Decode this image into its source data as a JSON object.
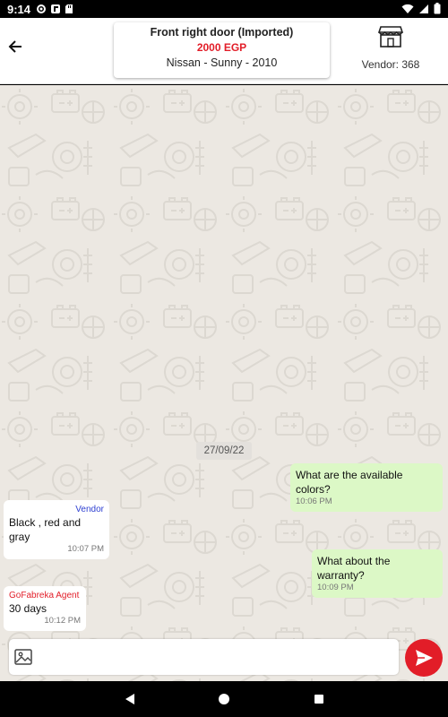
{
  "status_bar": {
    "time": "9:14"
  },
  "header": {
    "product_title": "Front right door (Imported)",
    "product_price": "2000 EGP",
    "product_car": "Nissan - Sunny - 2010",
    "vendor_label": "Vendor: 368"
  },
  "chat": {
    "date_separator": "27/09/22",
    "messages": [
      {
        "direction": "out",
        "sender": "",
        "text": "What are the available colors?",
        "time": "10:06 PM"
      },
      {
        "direction": "in",
        "sender": "Vendor",
        "text": "Black , red and gray",
        "time": "10:07 PM"
      },
      {
        "direction": "out",
        "sender": "",
        "text": "What about the warranty?",
        "time": "10:09 PM"
      },
      {
        "direction": "in",
        "sender": "GoFabreka Agent",
        "text": "30 days",
        "time": "10:12 PM"
      }
    ]
  },
  "composer": {
    "value": "",
    "placeholder": ""
  },
  "colors": {
    "accent": "#e21d28",
    "outgoing_bubble": "#dcf8c6",
    "incoming_bubble": "#ffffff",
    "chat_background": "#ece8e2",
    "vendor_sender": "#2d3fd1",
    "agent_sender": "#e21d28"
  },
  "icons": {
    "back": "arrow-left-icon",
    "vendor": "storefront-icon",
    "attach": "image-icon",
    "send": "send-icon",
    "nav_back": "triangle-back-icon",
    "nav_home": "circle-home-icon",
    "nav_recents": "square-recents-icon"
  }
}
